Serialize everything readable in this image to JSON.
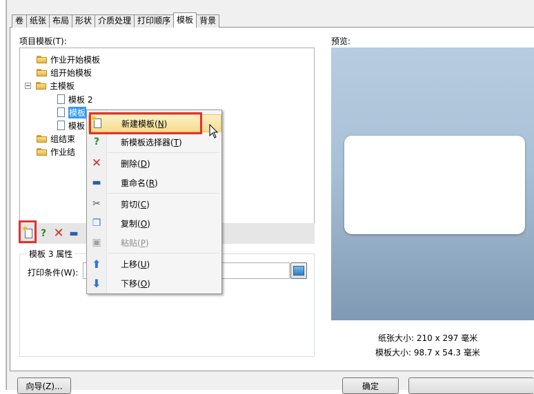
{
  "tabs": [
    "卷",
    "纸张",
    "布局",
    "形状",
    "介质处理",
    "打印顺序",
    "模板",
    "背景"
  ],
  "active_tab": "模板",
  "tree": {
    "label": "项目模板(T):",
    "items": {
      "work_start": "作业开始模板",
      "group_start": "组开始模板",
      "main": "主模板",
      "tpl2": "模板 2",
      "tpl3_partial": "模板",
      "tpl_other_partial": "模板",
      "group_end_partial": "组结束",
      "work_end_partial": "作业结"
    }
  },
  "properties": {
    "title": "模板 3 属性",
    "print_condition_label": "打印条件(W):",
    "print_condition_value": ""
  },
  "preview": {
    "label": "预览:",
    "paper_size": "纸张大小:  210 x 297 毫米",
    "template_size": "模板大小:  98.7 x 54.3 毫米"
  },
  "context_menu": {
    "items": [
      {
        "label": "新建模板(",
        "key": "N",
        "suffix": ")",
        "icon": "new-template-icon"
      },
      {
        "label": "新模板选择器(",
        "key": "T",
        "suffix": ")",
        "icon": "template-selector-icon"
      },
      {
        "label": "删除(",
        "key": "D",
        "suffix": ")",
        "icon": "delete-icon"
      },
      {
        "label": "重命名(",
        "key": "R",
        "suffix": ")",
        "icon": "rename-icon"
      },
      {
        "label": "剪切(",
        "key": "C",
        "suffix": ")",
        "icon": "cut-icon"
      },
      {
        "label": "复制(",
        "key": "O",
        "suffix": ")",
        "icon": "copy-icon"
      },
      {
        "label": "粘贴(",
        "key": "P",
        "suffix": ")",
        "icon": "paste-icon"
      },
      {
        "label": "上移(",
        "key": "U",
        "suffix": ")",
        "icon": "move-up-icon"
      },
      {
        "label": "下移(",
        "key": "O",
        "suffix": ")",
        "icon": "move-down-icon"
      }
    ]
  },
  "buttons": {
    "wizard": "向导(Z)...",
    "ok": "确定"
  },
  "colors": {
    "highlight_box": "#e3312f",
    "tree_selection": "#3399ff",
    "menu_hover": "#f7dc8f"
  }
}
